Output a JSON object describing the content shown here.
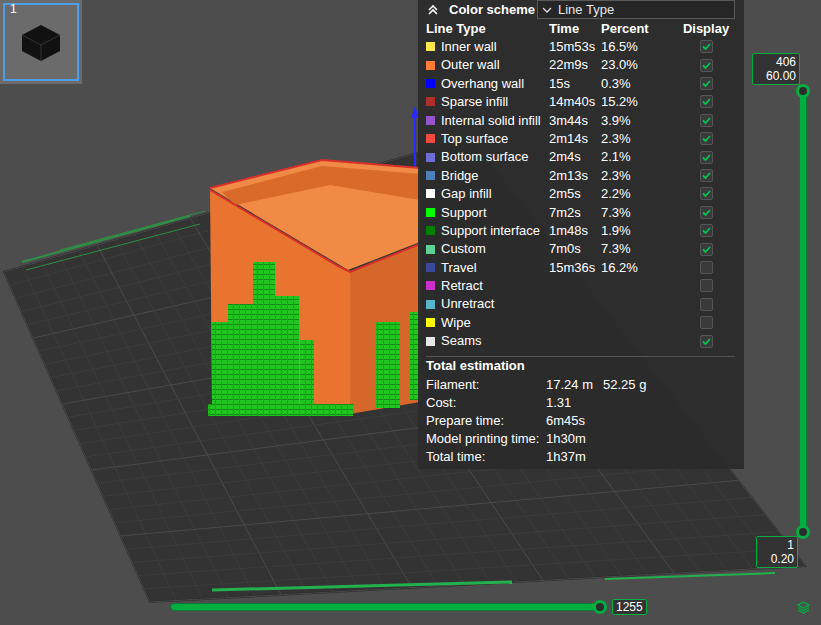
{
  "plate_thumbnail": {
    "label": "1",
    "selected": true
  },
  "legend": {
    "title": "Color scheme",
    "scheme_dropdown": {
      "value": "Line Type"
    },
    "columns": [
      "Line Type",
      "Time",
      "Percent",
      "Display"
    ],
    "rows": [
      {
        "label": "Inner wall",
        "time": "15m53s",
        "percent": "16.5%",
        "color": "#ffe64d",
        "displayed": true
      },
      {
        "label": "Outer wall",
        "time": "22m9s",
        "percent": "23.0%",
        "color": "#ff7d38",
        "displayed": true
      },
      {
        "label": "Overhang wall",
        "time": "15s",
        "percent": "0.3%",
        "color": "#0000ff",
        "displayed": true
      },
      {
        "label": "Sparse infill",
        "time": "14m40s",
        "percent": "15.2%",
        "color": "#b03029",
        "displayed": true
      },
      {
        "label": "Internal solid infill",
        "time": "3m44s",
        "percent": "3.9%",
        "color": "#9654cc",
        "displayed": true
      },
      {
        "label": "Top surface",
        "time": "2m14s",
        "percent": "2.3%",
        "color": "#f04a3e",
        "displayed": true
      },
      {
        "label": "Bottom surface",
        "time": "2m4s",
        "percent": "2.1%",
        "color": "#6d6dd8",
        "displayed": true
      },
      {
        "label": "Bridge",
        "time": "2m13s",
        "percent": "2.3%",
        "color": "#4d80ba",
        "displayed": true
      },
      {
        "label": "Gap infill",
        "time": "2m5s",
        "percent": "2.2%",
        "color": "#ffffff",
        "displayed": true
      },
      {
        "label": "Support",
        "time": "7m2s",
        "percent": "7.3%",
        "color": "#00ff00",
        "displayed": true
      },
      {
        "label": "Support interface",
        "time": "1m48s",
        "percent": "1.9%",
        "color": "#008000",
        "displayed": true
      },
      {
        "label": "Custom",
        "time": "7m0s",
        "percent": "7.3%",
        "color": "#5ed194",
        "displayed": true
      },
      {
        "label": "Travel",
        "time": "15m36s",
        "percent": "16.2%",
        "color": "#38489a",
        "displayed": false
      },
      {
        "label": "Retract",
        "color": "#cd2fce",
        "displayed": false
      },
      {
        "label": "Unretract",
        "color": "#56b4cc",
        "displayed": false
      },
      {
        "label": "Wipe",
        "color": "#ffff00",
        "displayed": false
      },
      {
        "label": "Seams",
        "color": "#e6e6e6",
        "displayed": true
      }
    ],
    "total": {
      "title": "Total estimation",
      "items": [
        {
          "label": "Filament:",
          "value": "17.24 m",
          "extra": "52.25 g"
        },
        {
          "label": "Cost:",
          "value": "1.31"
        },
        {
          "label": "Prepare time:",
          "value": "6m45s"
        },
        {
          "label": "Model printing time:",
          "value": "1h30m"
        },
        {
          "label": "Total time:",
          "value": "1h37m"
        }
      ]
    }
  },
  "layer_slider": {
    "upper_layer": "406",
    "upper_height": "60.00",
    "lower_layer": "1",
    "lower_height": "0.20",
    "upper_level": 1,
    "lower_level": 0
  },
  "move_slider": {
    "value": "1255",
    "level": 1
  }
}
